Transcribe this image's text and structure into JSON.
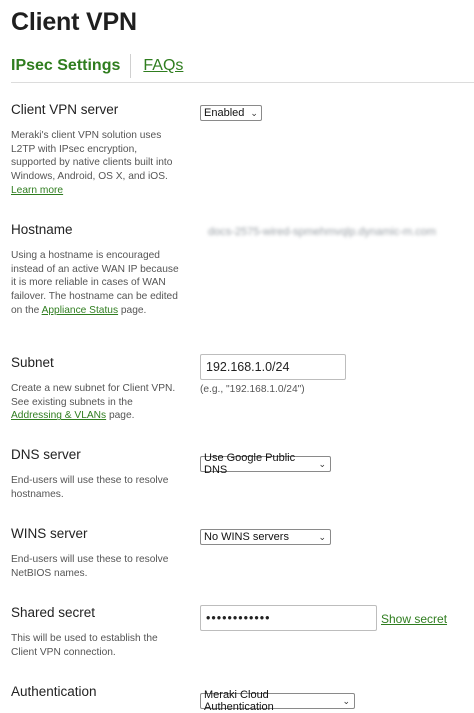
{
  "page": {
    "title": "Client VPN"
  },
  "tabs": {
    "active": "IPsec Settings",
    "other": "FAQs"
  },
  "server": {
    "label": "Client VPN server",
    "value": "Enabled",
    "desc": "Meraki's client VPN solution uses L2TP with IPsec encryption, supported by native clients built into Windows, Android, OS X, and iOS. ",
    "link": "Learn more"
  },
  "hostname": {
    "label": "Hostname",
    "value": "docs-2575-wired-spmehmvqlp.dynamic-m.com",
    "desc": "Using a hostname is encouraged instead of an active WAN IP because it is more reliable in cases of WAN failover. The hostname can be edited on the ",
    "link": "Appliance Status",
    "desc_end": " page."
  },
  "subnet": {
    "label": "Subnet",
    "value": "192.168.1.0/24",
    "hint": "(e.g., \"192.168.1.0/24\")",
    "desc": "Create a new subnet for Client VPN. See existing subnets in the ",
    "link": "Addressing & VLANs",
    "desc_end": " page."
  },
  "dns": {
    "label": "DNS server",
    "value": "Use Google Public DNS",
    "desc": "End-users will use these to resolve hostnames."
  },
  "wins": {
    "label": "WINS server",
    "value": "No WINS servers",
    "desc": "End-users will use these to resolve NetBIOS names."
  },
  "secret": {
    "label": "Shared secret",
    "value": "••••••••••••",
    "show": "Show secret",
    "desc": "This will be used to establish the Client VPN connection."
  },
  "auth": {
    "label": "Authentication",
    "value": "Meraki Cloud Authentication"
  }
}
